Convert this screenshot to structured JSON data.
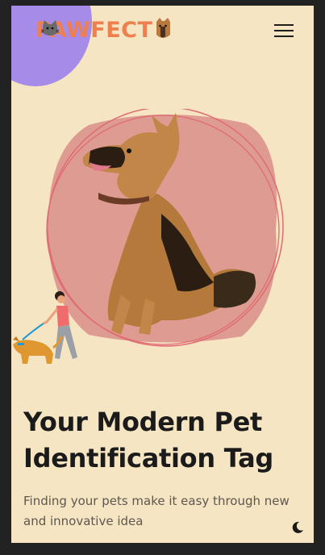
{
  "header": {
    "logo_text": "PAWFECT",
    "menu_icon": "hamburger-menu-icon"
  },
  "hero": {
    "image": "german-shepherd-dog-illustration",
    "decoration": "person-walking-dog-illustration"
  },
  "main": {
    "title": "Your Modern Pet Identification Tag",
    "subtitle": "Finding your pets make it easy through new and innovative idea"
  },
  "footer": {
    "theme_toggle_icon": "moon-icon"
  },
  "colors": {
    "background": "#f6e5c3",
    "accent_purple": "#a78be8",
    "logo_orange": "#ee7f4e",
    "blob_pink": "#de9b92",
    "ring_red": "#e06b72",
    "text_dark": "#1b1b1b"
  }
}
